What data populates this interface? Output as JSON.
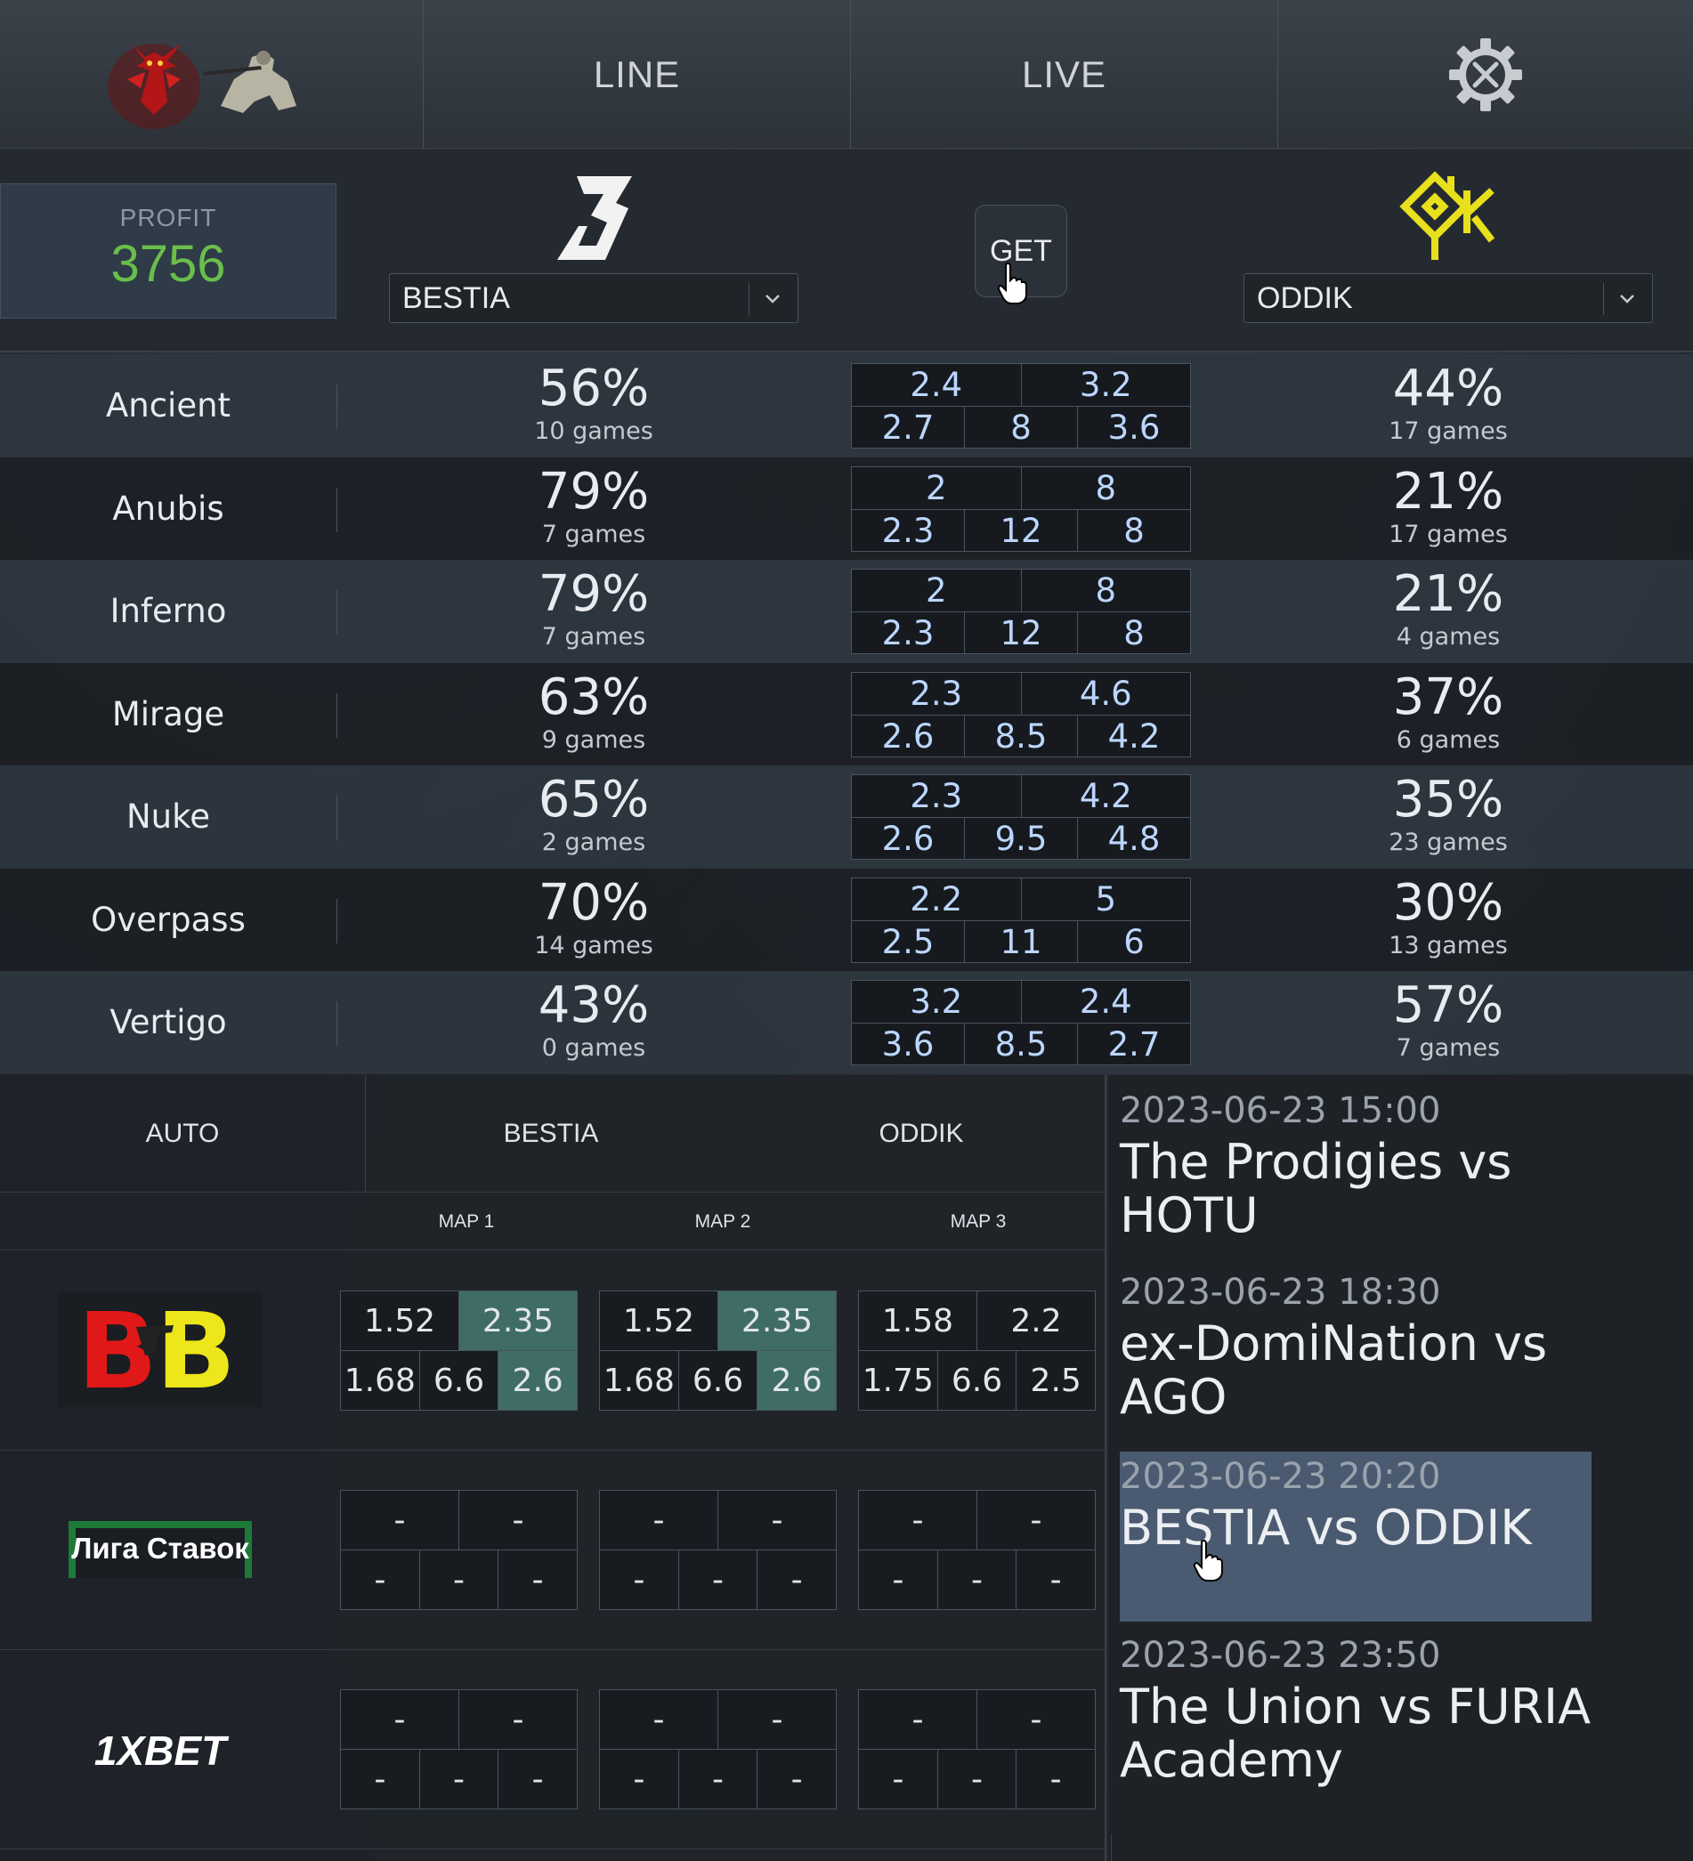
{
  "nav": {
    "tabs": [
      {
        "label": "LINE"
      },
      {
        "label": "LIVE"
      }
    ],
    "settings_icon": "gear-icon"
  },
  "profit": {
    "label": "PROFIT",
    "value": "3756",
    "value_color": "#6abf4b"
  },
  "team1": {
    "name": "BESTIA"
  },
  "team2": {
    "name": "ODDIK"
  },
  "get_button": {
    "label": "GET"
  },
  "maps": [
    {
      "name": "Ancient",
      "t1_pct": "56%",
      "t1_games": "10 games",
      "odds_top": [
        "2.4",
        "3.2"
      ],
      "odds_bot": [
        "2.7",
        "8",
        "3.6"
      ],
      "t2_pct": "44%",
      "t2_games": "17 games"
    },
    {
      "name": "Anubis",
      "t1_pct": "79%",
      "t1_games": "7 games",
      "odds_top": [
        "2",
        "8"
      ],
      "odds_bot": [
        "2.3",
        "12",
        "8"
      ],
      "t2_pct": "21%",
      "t2_games": "17 games"
    },
    {
      "name": "Inferno",
      "t1_pct": "79%",
      "t1_games": "7 games",
      "odds_top": [
        "2",
        "8"
      ],
      "odds_bot": [
        "2.3",
        "12",
        "8"
      ],
      "t2_pct": "21%",
      "t2_games": "4 games"
    },
    {
      "name": "Mirage",
      "t1_pct": "63%",
      "t1_games": "9 games",
      "odds_top": [
        "2.3",
        "4.6"
      ],
      "odds_bot": [
        "2.6",
        "8.5",
        "4.2"
      ],
      "t2_pct": "37%",
      "t2_games": "6 games"
    },
    {
      "name": "Nuke",
      "t1_pct": "65%",
      "t1_games": "2 games",
      "odds_top": [
        "2.3",
        "4.2"
      ],
      "odds_bot": [
        "2.6",
        "9.5",
        "4.8"
      ],
      "t2_pct": "35%",
      "t2_games": "23 games"
    },
    {
      "name": "Overpass",
      "t1_pct": "70%",
      "t1_games": "14 games",
      "odds_top": [
        "2.2",
        "5"
      ],
      "odds_bot": [
        "2.5",
        "11",
        "6"
      ],
      "t2_pct": "30%",
      "t2_games": "13 games"
    },
    {
      "name": "Vertigo",
      "t1_pct": "43%",
      "t1_games": "0 games",
      "odds_top": [
        "3.2",
        "2.4"
      ],
      "odds_bot": [
        "3.6",
        "8.5",
        "2.7"
      ],
      "t2_pct": "57%",
      "t2_games": "7 games"
    }
  ],
  "auto_bar": {
    "auto": "AUTO",
    "team1": "BESTIA",
    "team2": "ODDIK"
  },
  "map_headers": [
    "MAP 1",
    "MAP 2",
    "MAP 3"
  ],
  "bookmakers": [
    {
      "name": "BB",
      "maps": [
        {
          "top": [
            "1.52",
            "2.35"
          ],
          "bot": [
            "1.68",
            "6.6",
            "2.6"
          ],
          "hl_top": [
            false,
            true
          ],
          "hl_bot": [
            false,
            false,
            true
          ]
        },
        {
          "top": [
            "1.52",
            "2.35"
          ],
          "bot": [
            "1.68",
            "6.6",
            "2.6"
          ],
          "hl_top": [
            false,
            true
          ],
          "hl_bot": [
            false,
            false,
            true
          ]
        },
        {
          "top": [
            "1.58",
            "2.2"
          ],
          "bot": [
            "1.75",
            "6.6",
            "2.5"
          ],
          "hl_top": [
            false,
            false
          ],
          "hl_bot": [
            false,
            false,
            false
          ]
        }
      ]
    },
    {
      "name": "Лига Ставок",
      "maps": [
        {
          "top": [
            "-",
            "-"
          ],
          "bot": [
            "-",
            "-",
            "-"
          ]
        },
        {
          "top": [
            "-",
            "-"
          ],
          "bot": [
            "-",
            "-",
            "-"
          ]
        },
        {
          "top": [
            "-",
            "-"
          ],
          "bot": [
            "-",
            "-",
            "-"
          ]
        }
      ]
    },
    {
      "name": "1XBET",
      "maps": [
        {
          "top": [
            "-",
            "-"
          ],
          "bot": [
            "-",
            "-",
            "-"
          ]
        },
        {
          "top": [
            "-",
            "-"
          ],
          "bot": [
            "-",
            "-",
            "-"
          ]
        },
        {
          "top": [
            "-",
            "-"
          ],
          "bot": [
            "-",
            "-",
            "-"
          ]
        }
      ]
    }
  ],
  "matches": [
    {
      "date": "2023-06-23 15:00",
      "title": "The Prodigies vs HOTU"
    },
    {
      "date": "2023-06-23 18:30",
      "title": "ex-DomiNation vs AGO"
    },
    {
      "date": "2023-06-23 20:20",
      "title": "BESTIA vs ODDIK",
      "selected": true
    },
    {
      "date": "2023-06-23 23:50",
      "title": "The Union vs FURIA Academy"
    }
  ],
  "colors": {
    "highlight_cell": "#3f6d66",
    "odds_text": "#bcd6ff",
    "selected_match": "#4a5a70",
    "oddik_logo": "#e8e01c"
  }
}
